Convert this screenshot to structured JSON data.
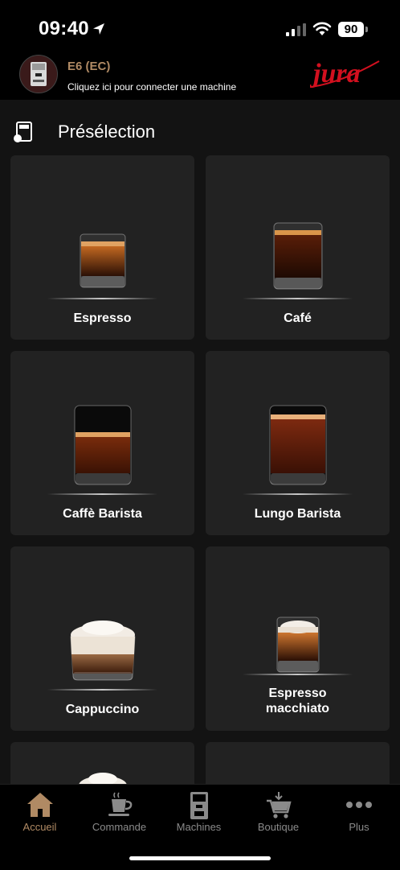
{
  "status": {
    "time": "09:40",
    "battery": "90"
  },
  "header": {
    "machine_name": "E6 (EC)",
    "machine_sub": "Cliquez ici pour connecter une machine",
    "brand": "jura"
  },
  "section": {
    "title": "Présélection"
  },
  "products": [
    {
      "label": "Espresso"
    },
    {
      "label": "Café"
    },
    {
      "label": "Caffè Barista"
    },
    {
      "label": "Lungo Barista"
    },
    {
      "label": "Cappuccino"
    },
    {
      "label_line1": "Espresso",
      "label_line2": "macchiato"
    }
  ],
  "tabs": [
    {
      "label": "Accueil",
      "icon": "home-icon"
    },
    {
      "label": "Commande",
      "icon": "coffee-cup-icon"
    },
    {
      "label": "Machines",
      "icon": "coffee-machine-icon"
    },
    {
      "label": "Boutique",
      "icon": "shopping-cart-icon"
    },
    {
      "label": "Plus",
      "icon": "more-dots-icon"
    }
  ],
  "colors": {
    "accent": "#b08a64",
    "brand_red": "#d3101f",
    "background": "#131313",
    "card": "#222222"
  }
}
